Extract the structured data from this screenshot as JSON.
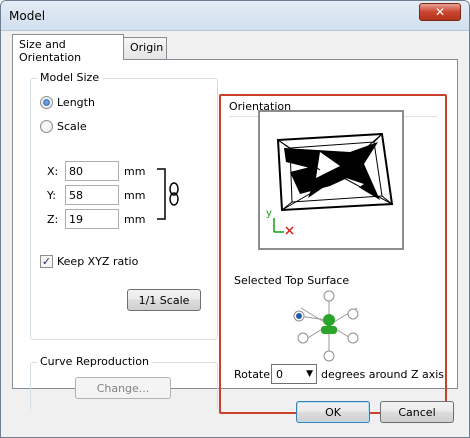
{
  "window": {
    "title": "Model",
    "close_glyph": "✕"
  },
  "tabs": [
    {
      "label": "Size and Orientation"
    },
    {
      "label": "Origin"
    }
  ],
  "model_size": {
    "title": "Model Size",
    "radio_length": "Length",
    "radio_scale": "Scale",
    "selected": "Length",
    "x_label": "X:",
    "x_value": "80",
    "y_label": "Y:",
    "y_value": "58",
    "z_label": "Z:",
    "z_value": "19",
    "unit": "mm",
    "keep_ratio_label": "Keep XYZ ratio",
    "keep_ratio_checked": true,
    "scale_button": "1/1 Scale"
  },
  "curve": {
    "title": "Curve Reproduction",
    "change_button": "Change..."
  },
  "orientation": {
    "title": "Orientation",
    "selected_top_surface_label": "Selected Top Surface",
    "axis_y_label": "y",
    "rotate_label": "Rotate",
    "rotate_value": "0",
    "degrees_label": "degrees around Z axis",
    "highlight_color": "#c9412a"
  },
  "footer": {
    "ok_button": "OK",
    "cancel_button": "Cancel"
  }
}
